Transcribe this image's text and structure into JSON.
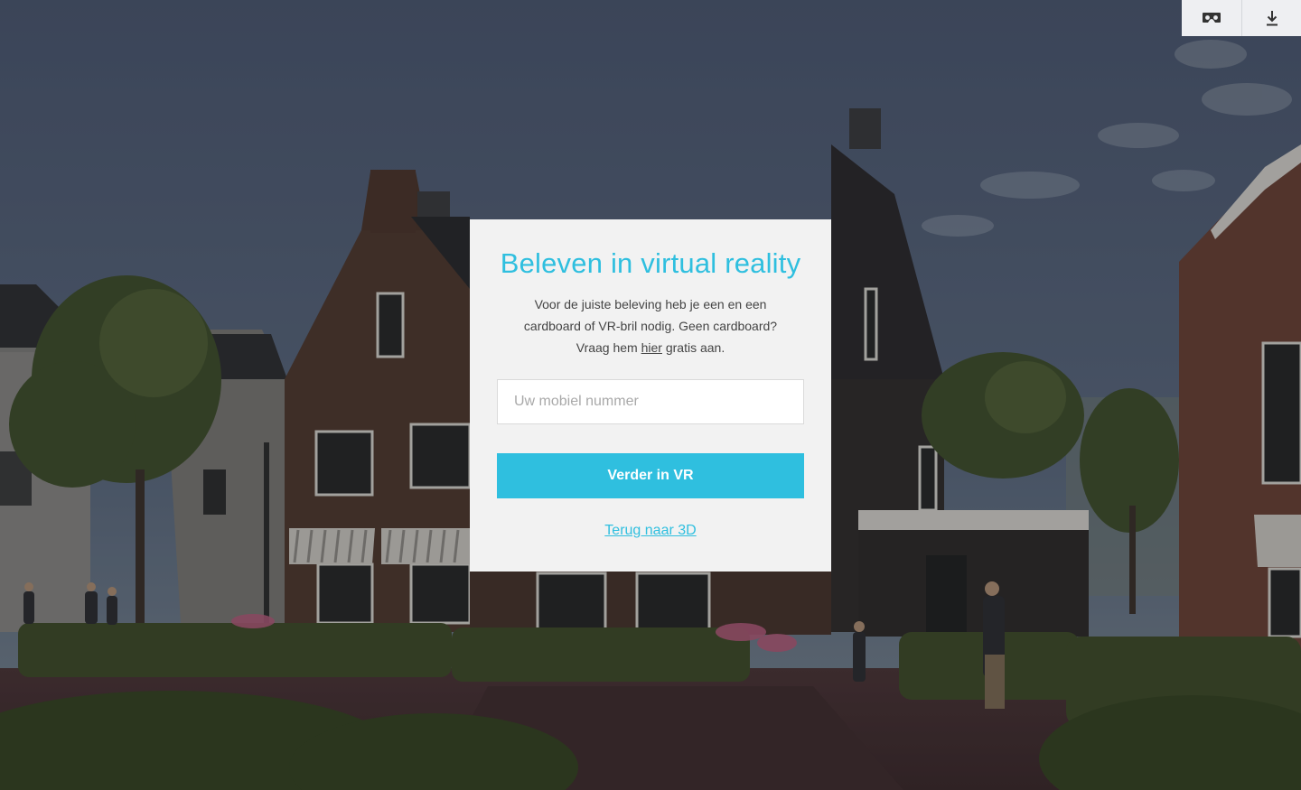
{
  "toolbar": {
    "vr_icon": "vr-headset-icon",
    "download_icon": "download-icon"
  },
  "modal": {
    "title": "Beleven in virtual reality",
    "text_before_link": "Voor de juiste beleving heb je een en een cardboard of VR-bril nodig. Geen cardboard? Vraag hem ",
    "link_label": "hier",
    "text_after_link": " gratis aan.",
    "phone_placeholder": "Uw mobiel nummer",
    "phone_value": "",
    "cta_label": "Verder in VR",
    "back_label": "Terug naar 3D"
  },
  "colors": {
    "accent": "#2fbfdf",
    "modal_bg": "#f2f2f2",
    "toolbar_bg": "#eeeff2"
  }
}
